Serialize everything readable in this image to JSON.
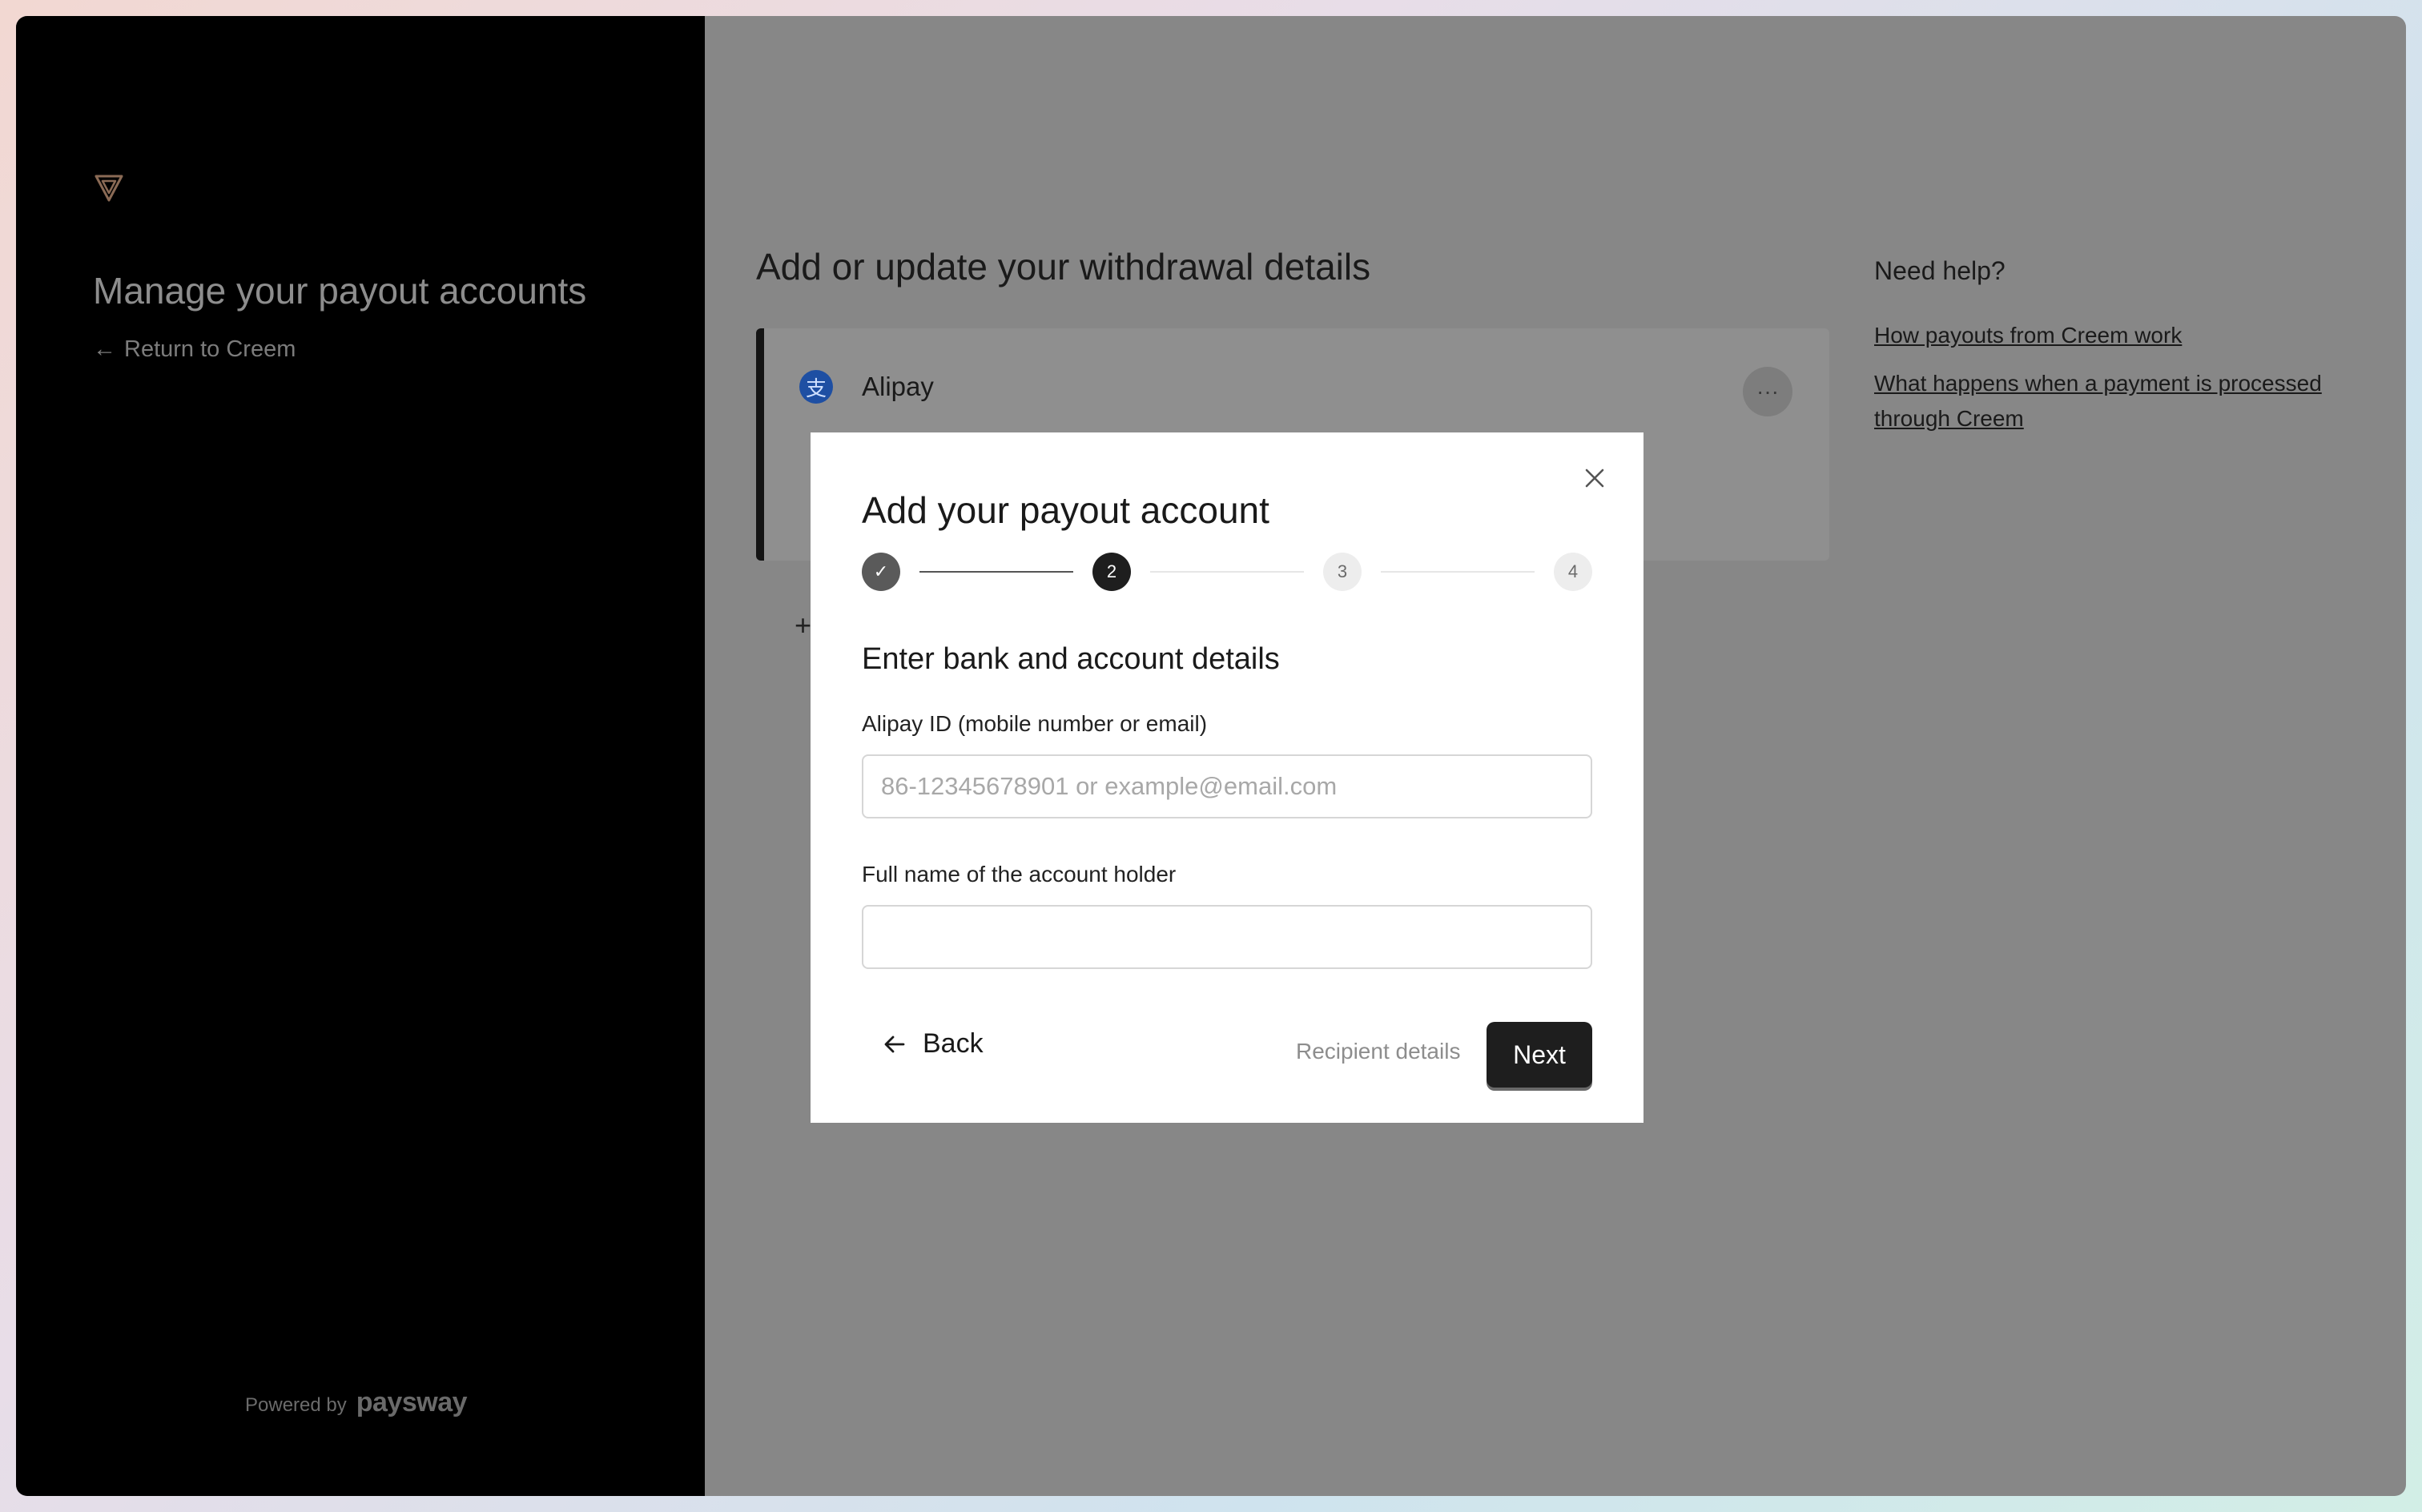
{
  "sidebar": {
    "title": "Manage your payout accounts",
    "return_link": "Return to Creem",
    "powered_by_label": "Powered by",
    "powered_by_brand": "paysway"
  },
  "main": {
    "title": "Add or update your withdrawal details",
    "account": {
      "name": "Alipay",
      "icon_glyph": "支",
      "menu_glyph": "···"
    }
  },
  "help": {
    "title": "Need help?",
    "links": [
      "How payouts from Creem work",
      "What happens when a payment is processed through Creem"
    ]
  },
  "modal": {
    "title": "Add your payout account",
    "steps": [
      {
        "label": "✓",
        "state": "done"
      },
      {
        "label": "2",
        "state": "current"
      },
      {
        "label": "3",
        "state": "todo"
      },
      {
        "label": "4",
        "state": "todo"
      }
    ],
    "section_title": "Enter bank and account details",
    "fields": {
      "alipay_id": {
        "label": "Alipay ID (mobile number or email)",
        "placeholder": "86-12345678901 or example@email.com",
        "value": ""
      },
      "full_name": {
        "label": "Full name of the account holder",
        "placeholder": "",
        "value": ""
      }
    },
    "back_label": "Back",
    "next_hint": "Recipient details",
    "next_label": "Next"
  },
  "colors": {
    "overlay": "#878787",
    "sidebar_bg": "#000000",
    "primary_button": "#1e1e1e",
    "alipay_blue": "#1e4fa3"
  }
}
